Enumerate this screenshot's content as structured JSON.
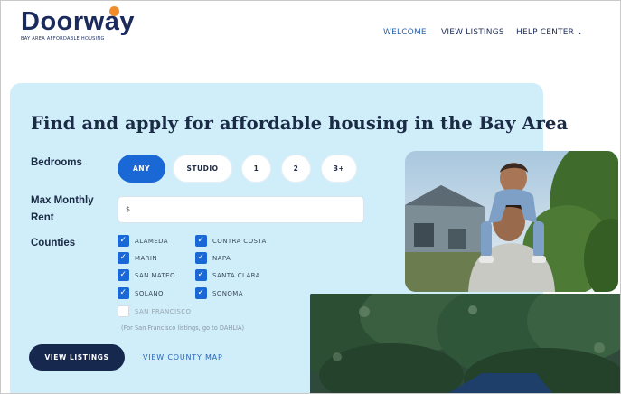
{
  "header": {
    "logo_text": "Doorway",
    "logo_tagline": "BAY AREA AFFORDABLE HOUSING",
    "nav": [
      {
        "label": "WELCOME"
      },
      {
        "label": "VIEW LISTINGS"
      },
      {
        "label": "HELP CENTER"
      }
    ]
  },
  "hero": {
    "headline": "Find and apply for affordable housing in the Bay Area"
  },
  "filters": {
    "bedrooms_label": "Bedrooms",
    "bedroom_options": [
      "ANY",
      "STUDIO",
      "1",
      "2",
      "3+"
    ],
    "selected_bedroom": "ANY",
    "rent_label_line1": "Max Monthly",
    "rent_label_line2": "Rent",
    "rent_value": "$",
    "counties_label": "Counties",
    "counties": [
      {
        "name": "ALAMEDA",
        "checked": true
      },
      {
        "name": "CONTRA COSTA",
        "checked": true
      },
      {
        "name": "MARIN",
        "checked": true
      },
      {
        "name": "NAPA",
        "checked": true
      },
      {
        "name": "SAN MATEO",
        "checked": true
      },
      {
        "name": "SANTA CLARA",
        "checked": true
      },
      {
        "name": "SOLANO",
        "checked": true
      },
      {
        "name": "SONOMA",
        "checked": true
      },
      {
        "name": "SAN FRANCISCO",
        "checked": false
      }
    ],
    "sf_note": "(For San Francisco listings, go to DAHLIA)"
  },
  "actions": {
    "view_listings": "VIEW LISTINGS",
    "view_county_map": "VIEW COUNTY MAP"
  },
  "colors": {
    "panel_bg": "#cfeefa",
    "primary": "#1a68d6",
    "navy": "#17284f",
    "logo_dot": "#f28c28"
  },
  "icons": {
    "nav_chevron": "chevron-down-icon",
    "checkbox": "checkmark-icon"
  }
}
